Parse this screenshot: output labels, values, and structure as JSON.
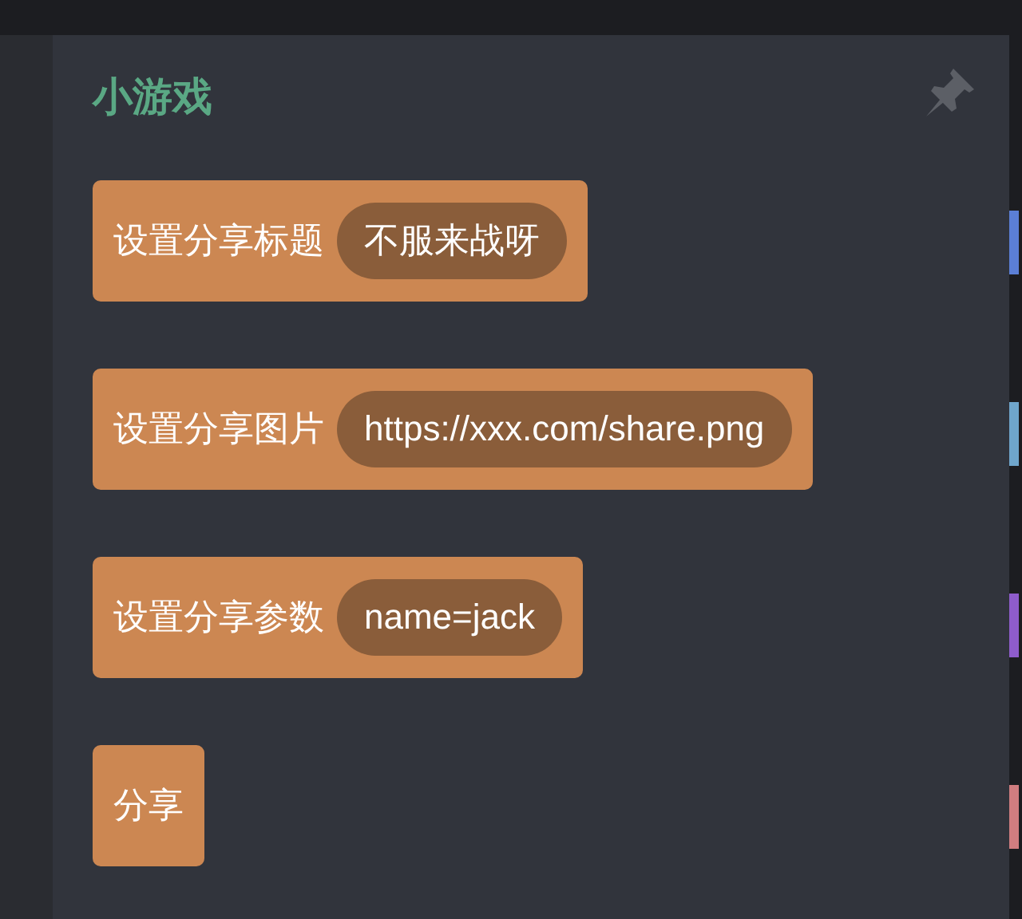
{
  "panel": {
    "title": "小游戏",
    "pinned": false
  },
  "blocks": [
    {
      "kind": "with_value",
      "label": "设置分享标题",
      "value": "不服来战呀"
    },
    {
      "kind": "with_value",
      "label": "设置分享图片",
      "value": "https://xxx.com/share.png"
    },
    {
      "kind": "with_value",
      "label": "设置分享参数",
      "value": "name=jack"
    },
    {
      "kind": "plain",
      "label": "分享"
    }
  ],
  "category_markers": [
    {
      "color": "#5b7fd6"
    },
    {
      "color": "#6fa6cc"
    },
    {
      "color": "#8e5ccc"
    },
    {
      "color": "#d07d80"
    }
  ]
}
